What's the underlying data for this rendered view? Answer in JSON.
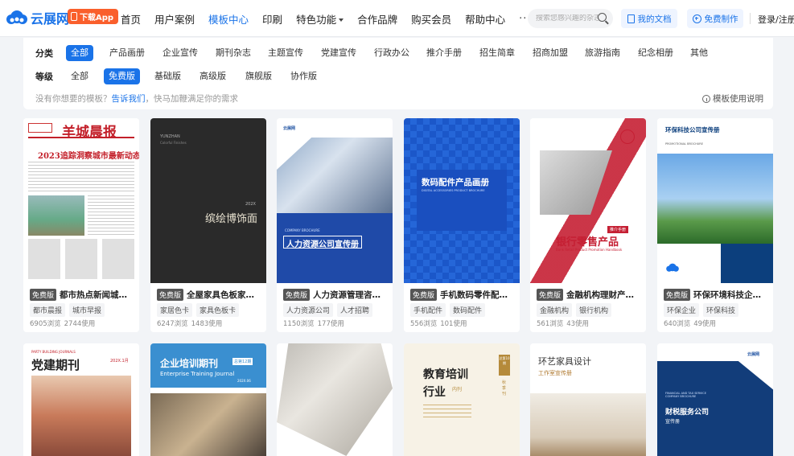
{
  "header": {
    "logo_text": "云展网",
    "app_button": "下载App",
    "nav": [
      "首页",
      "用户案例",
      "模板中心",
      "印刷",
      "特色功能",
      "合作品牌",
      "购买会员",
      "帮助中心"
    ],
    "nav_more": "···",
    "search_placeholder": "搜索您感兴趣的杂志",
    "my_docs": "我的文档",
    "free_make": "免费制作",
    "login": "登录/注册",
    "accent": "#1a73e8"
  },
  "filter": {
    "category_label": "分类",
    "categories": [
      "全部",
      "产品画册",
      "企业宣传",
      "期刊杂志",
      "主题宣传",
      "党建宣传",
      "行政办公",
      "推介手册",
      "招生简章",
      "招商加盟",
      "旅游指南",
      "纪念相册",
      "其他"
    ],
    "level_label": "等级",
    "levels": [
      "全部",
      "免费版",
      "基础版",
      "高级版",
      "旗舰版",
      "协作版"
    ],
    "hint_prefix": "没有你想要的模板？",
    "hint_link": "告诉我们",
    "hint_suffix": "，快马加鞭满足你的需求",
    "usage_guide": "模板使用说明"
  },
  "cards": [
    {
      "badge": "免费版",
      "title": "都市热点新闻城市...",
      "tags": [
        "都市晨报",
        "城市早报"
      ],
      "views": "6905浏览",
      "uses": "2744使用"
    },
    {
      "badge": "免费版",
      "title": "全屋家具色板家居...",
      "tags": [
        "家居色卡",
        "家具色板卡"
      ],
      "views": "6247浏览",
      "uses": "1483使用"
    },
    {
      "badge": "免费版",
      "title": "人力资源管理咨询...",
      "tags": [
        "人力资源公司",
        "人才招聘"
      ],
      "views": "1150浏览",
      "uses": "177使用"
    },
    {
      "badge": "免费版",
      "title": "手机数码零件配件...",
      "tags": [
        "手机配件",
        "数码配件"
      ],
      "views": "556浏览",
      "uses": "101使用"
    },
    {
      "badge": "免费版",
      "title": "金融机构理财产品...",
      "tags": [
        "金融机构",
        "银行机构"
      ],
      "views": "561浏览",
      "uses": "43使用"
    },
    {
      "badge": "免费版",
      "title": "环保环境科技企业...",
      "tags": [
        "环保企业",
        "环保科技"
      ],
      "views": "640浏览",
      "uses": "49使用"
    }
  ],
  "covers": {
    "c1_title": "羊城晨报",
    "c1_headline": "2023追踪洞察城市最新动态",
    "c2_brand": "YUNZHAN",
    "c2_sub": "Colorful Finishes",
    "c2_year": "202X",
    "c2_title": "缤绘博饰面",
    "c3_brand": "云展网",
    "c3_en": "COMPANY BROCHURE",
    "c3_title": "人力资源公司宣传册",
    "c4_title": "数码配件产品画册",
    "c4_en": "DIGITAL ACCESSORIES PRODUCT BROCHURE",
    "c5_tag": "推介手册",
    "c5_title": "银行零售产品",
    "c5_en": "Bank Retail Product Promotion Handbook",
    "c6_title": "环保科技公司宣传册",
    "c6_en": "PROMOTIONAL BROCHURE",
    "r2_1_title": "党建期刊",
    "r2_1_en": "PARTY BUILDING JOURNALS",
    "r2_1_year": "202X.1月",
    "r2_2_title": "企业培训期刊",
    "r2_2_en": "Enterprise Training Journal",
    "r2_2_issue": "总第12期",
    "r2_2_date": "202X.06",
    "r2_4_title1": "教育培训",
    "r2_4_title2": "行业",
    "r2_4_sub": "内刊",
    "r2_4_season": "秋季刊",
    "r2_4_tag": "总第10期",
    "r2_5_title": "环艺家具设计",
    "r2_5_sub": "工作室宣传册",
    "r2_6_brand": "云展网",
    "r2_6_en": "FINANCIAL AND TAX SERVICE COMPANY BROCHURE",
    "r2_6_title": "财税服务公司",
    "r2_6_sub": "宣传册"
  }
}
